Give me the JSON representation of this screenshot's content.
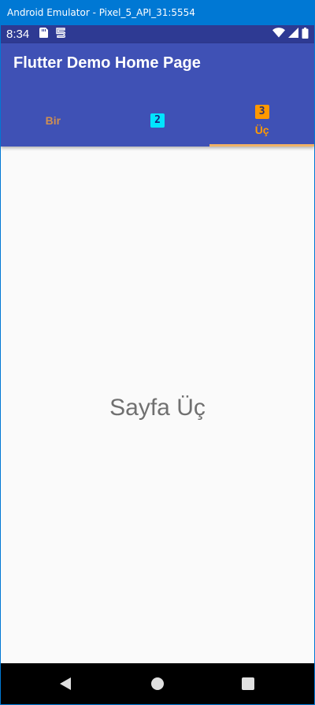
{
  "window": {
    "title": "Android Emulator - Pixel_5_API_31:5554"
  },
  "status_bar": {
    "time": "8:34",
    "left_icons": [
      "sim-card-icon",
      "flutter-debug-icon"
    ],
    "right_icons": [
      "wifi-icon",
      "cell-signal-icon",
      "battery-icon"
    ]
  },
  "app_bar": {
    "title": "Flutter Demo Home Page"
  },
  "tabs": [
    {
      "label": "Bir",
      "icon_number": "",
      "selected": false
    },
    {
      "label": "",
      "icon_number": "2",
      "selected": false
    },
    {
      "label": "Üç",
      "icon_number": "3",
      "selected": true
    }
  ],
  "content": {
    "text": "Sayfa Üç"
  },
  "nav_bar": {
    "buttons": [
      "back-icon",
      "home-icon",
      "recents-icon"
    ]
  },
  "colors": {
    "app_bar": "#3f51b5",
    "status_bar": "#2e3a93",
    "tab_active": "#ff9800",
    "tab_inactive": "#cf8f52",
    "tab_icon_2": "#00e5ff",
    "tab_icon_3": "#ff9800",
    "window_titlebar": "#0078d4"
  }
}
